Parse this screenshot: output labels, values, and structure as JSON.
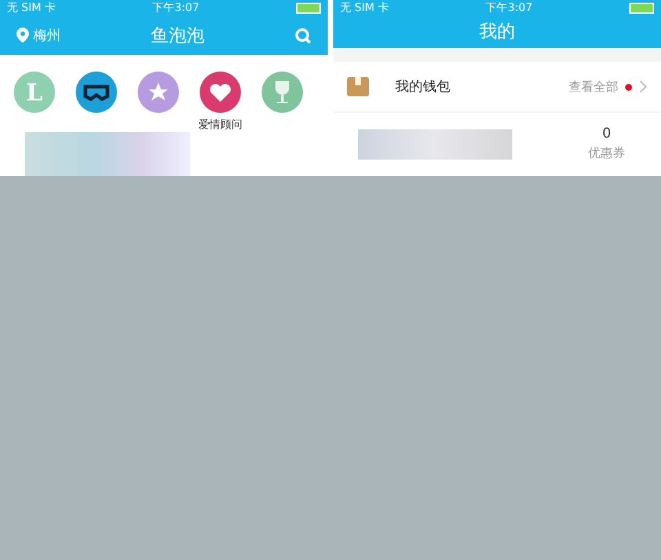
{
  "left_screen": {
    "status_bar": {
      "carrier": "无 SIM 卡",
      "time": "下午3:07"
    },
    "location": "梅州",
    "title": "鱼泡泡",
    "shortcuts": [
      {
        "kind": "letter",
        "glyph": "L",
        "color": "#8fd0b0"
      },
      {
        "kind": "mask",
        "color": "#1e9fd8"
      },
      {
        "kind": "star",
        "color": "#b79be0"
      },
      {
        "kind": "heart",
        "color": "#d93b6e",
        "label": "爱情顾问"
      },
      {
        "kind": "cup",
        "color": "#7fc49a"
      }
    ]
  },
  "right_screen": {
    "status_bar": {
      "carrier": "无 SIM 卡",
      "time": "下午3:07"
    },
    "title": "我的",
    "wallet": {
      "label": "我的钱包",
      "link": "查看全部",
      "badge": true
    },
    "stats": [
      {
        "value": "0",
        "label": "优惠券"
      }
    ]
  }
}
